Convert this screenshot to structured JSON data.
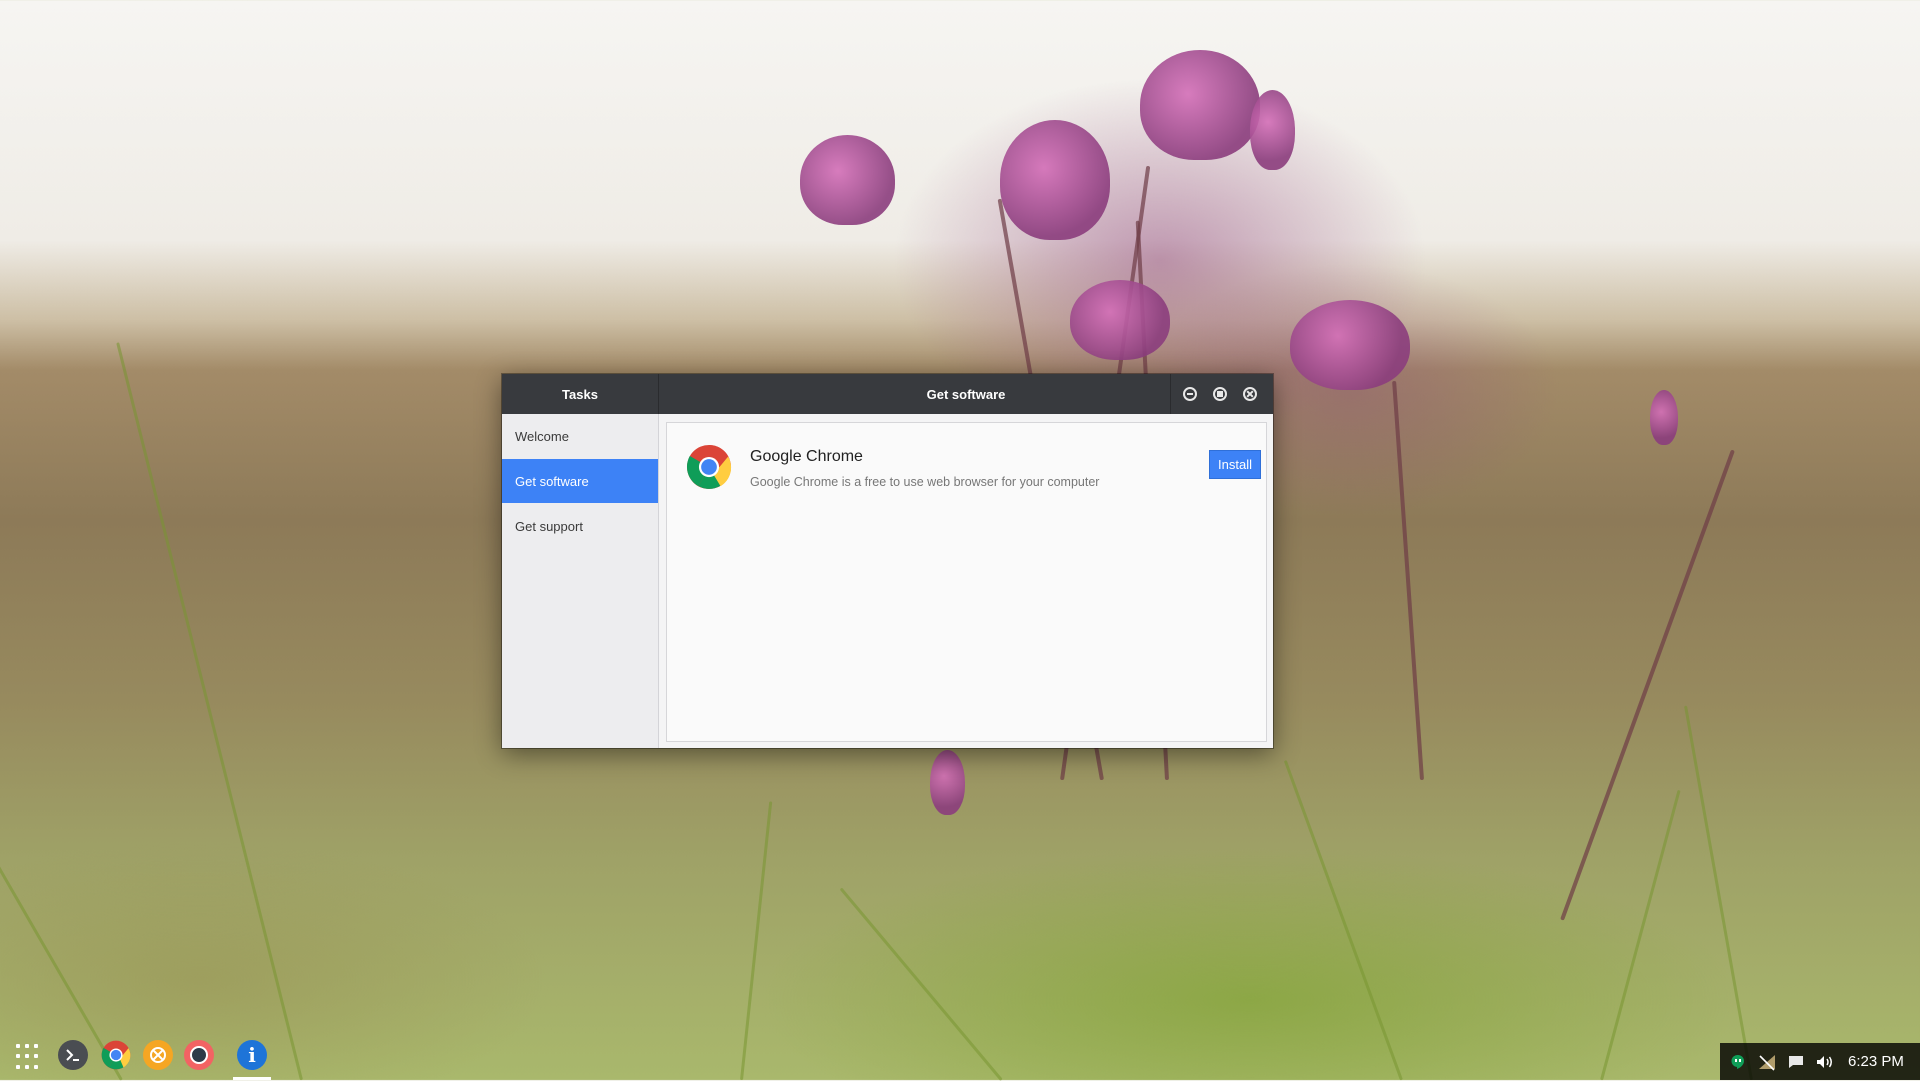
{
  "desktop": {
    "wallpaper": "field-flowers-photo"
  },
  "window": {
    "sidebar_title": "Tasks",
    "title": "Get software",
    "controls": {
      "minimize_icon": "minimize-icon",
      "maximize_icon": "maximize-icon",
      "close_icon": "close-icon"
    },
    "sidebar": {
      "items": [
        {
          "label": "Welcome",
          "active": false
        },
        {
          "label": "Get software",
          "active": true
        },
        {
          "label": "Get support",
          "active": false
        }
      ]
    },
    "apps": [
      {
        "name": "Google Chrome",
        "description": "Google Chrome is a free to use web browser for your computer",
        "icon": "chrome-icon",
        "action_label": "Install"
      }
    ]
  },
  "taskbar": {
    "launcher_icon": "app-launcher-grid-icon",
    "pinned": [
      {
        "name": "terminal",
        "icon": "terminal-icon",
        "color": "#4a4d52"
      },
      {
        "name": "chrome",
        "icon": "chrome-icon",
        "color": "#ffffff"
      },
      {
        "name": "app-yellow",
        "icon": "yellow-app-icon",
        "color": "#f5a623"
      },
      {
        "name": "app-red",
        "icon": "red-app-icon",
        "color": "#f26363"
      },
      {
        "name": "info",
        "icon": "info-icon",
        "color": "#1e74d8"
      }
    ],
    "tray": {
      "icons": [
        "hangouts-icon",
        "network-icon",
        "notifications-icon",
        "volume-icon"
      ],
      "time": "6:23 PM"
    }
  },
  "colors": {
    "accent": "#3d82f6",
    "titlebar": "#383a3e"
  }
}
